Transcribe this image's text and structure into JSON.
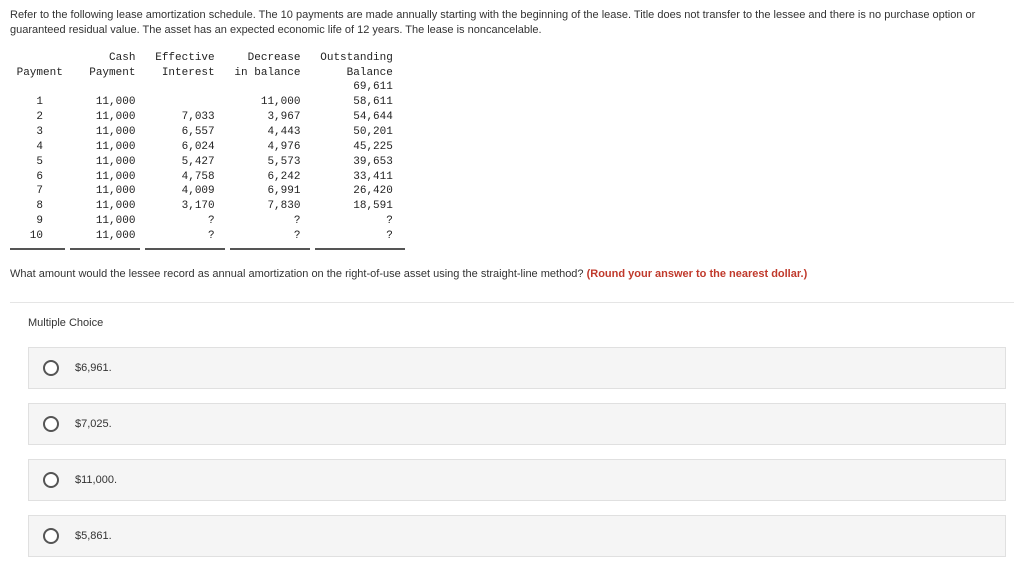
{
  "intro": "Refer to the following lease amortization schedule. The 10 payments are made annually starting with the beginning of the lease. Title does not transfer to the lessee and there is no purchase option or guaranteed residual value. The asset has an expected economic life of 12 years. The lease is noncancelable.",
  "table": {
    "headers": {
      "payment": "Payment",
      "cash": "Cash Payment",
      "interest": "Effective Interest",
      "decrease": "Decrease in balance",
      "balance": "Outstanding Balance"
    },
    "initial_balance": "69,611",
    "rows": [
      {
        "n": "1",
        "cash": "11,000",
        "int": "",
        "dec": "11,000",
        "bal": "58,611"
      },
      {
        "n": "2",
        "cash": "11,000",
        "int": "7,033",
        "dec": "3,967",
        "bal": "54,644"
      },
      {
        "n": "3",
        "cash": "11,000",
        "int": "6,557",
        "dec": "4,443",
        "bal": "50,201"
      },
      {
        "n": "4",
        "cash": "11,000",
        "int": "6,024",
        "dec": "4,976",
        "bal": "45,225"
      },
      {
        "n": "5",
        "cash": "11,000",
        "int": "5,427",
        "dec": "5,573",
        "bal": "39,653"
      },
      {
        "n": "6",
        "cash": "11,000",
        "int": "4,758",
        "dec": "6,242",
        "bal": "33,411"
      },
      {
        "n": "7",
        "cash": "11,000",
        "int": "4,009",
        "dec": "6,991",
        "bal": "26,420"
      },
      {
        "n": "8",
        "cash": "11,000",
        "int": "3,170",
        "dec": "7,830",
        "bal": "18,591"
      },
      {
        "n": "9",
        "cash": "11,000",
        "int": "?",
        "dec": "?",
        "bal": "?"
      },
      {
        "n": "10",
        "cash": "11,000",
        "int": "?",
        "dec": "?",
        "bal": "?"
      }
    ]
  },
  "question": {
    "text": "What amount would the lessee record as annual amortization on the right-of-use asset using the straight-line method? ",
    "round": "(Round your answer to the nearest dollar.)"
  },
  "mc": {
    "label": "Multiple Choice",
    "options": [
      "$6,961.",
      "$7,025.",
      "$11,000.",
      "$5,861."
    ]
  }
}
